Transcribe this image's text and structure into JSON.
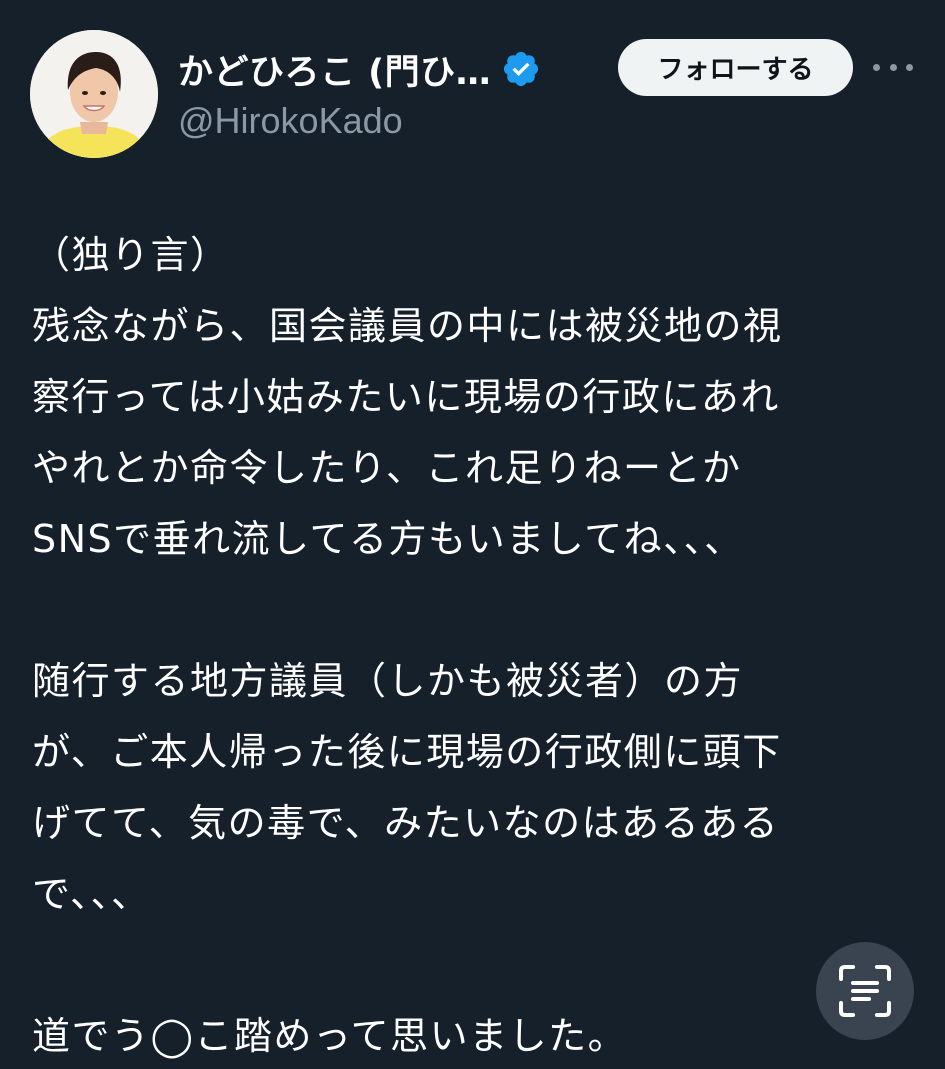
{
  "author": {
    "display_name": "かどひろこ (門ひ…",
    "handle": "@HirokoKado",
    "verified": true,
    "avatar_icon": "profile-photo"
  },
  "actions": {
    "follow_label": "フォローする",
    "more_icon": "more-horizontal-icon",
    "scan_icon": "text-scan-icon"
  },
  "tweet": {
    "lines": [
      "（独り言）",
      "残念ながら、国会議員の中には被災地の視",
      "察行っては小姑みたいに現場の行政にあれ",
      "やれとか命令したり、これ足りねーとか",
      "SNSで垂れ流してる方もいましてね、、、",
      "",
      "随行する地方議員（しかも被災者）の方",
      "が、ご本人帰った後に現場の行政側に頭下",
      "げてて、気の毒で、みたいなのはあるある",
      "で、、、",
      "",
      "道でう◯こ踏めって思いました。"
    ]
  },
  "colors": {
    "background": "#15202b",
    "text": "#ffffff",
    "muted": "#8b98a5",
    "verified_blue": "#1d9bf0",
    "button_bg": "#eff3f4"
  }
}
